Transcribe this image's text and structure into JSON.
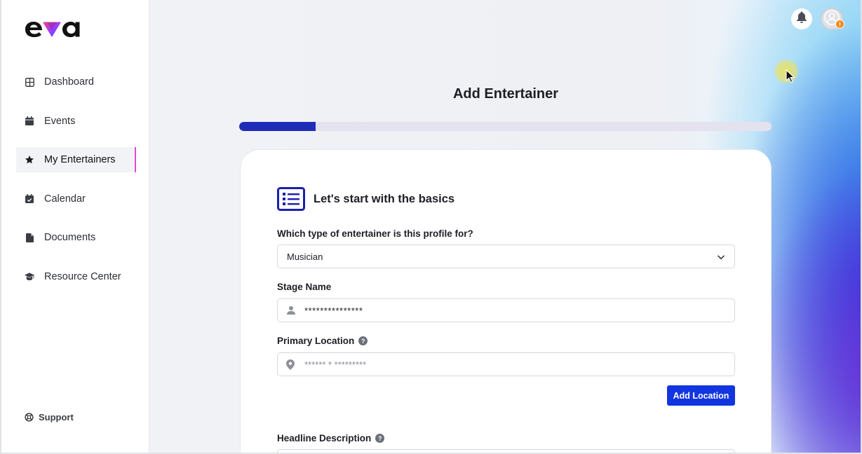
{
  "app": {
    "logo_text": "eva"
  },
  "sidebar": {
    "items": [
      {
        "label": "Dashboard",
        "icon": "grid-icon"
      },
      {
        "label": "Events",
        "icon": "calendar-icon"
      },
      {
        "label": "My Entertainers",
        "icon": "star-icon",
        "active": true
      },
      {
        "label": "Calendar",
        "icon": "calendar-check-icon"
      },
      {
        "label": "Documents",
        "icon": "document-icon"
      },
      {
        "label": "Resource Center",
        "icon": "graduation-cap-icon"
      }
    ],
    "support_label": "Support"
  },
  "header": {
    "notification_icon": "bell-icon",
    "avatar_icon": "user-avatar-icon",
    "avatar_badge": "!"
  },
  "page": {
    "title": "Add Entertainer",
    "progress_fraction": 0.143
  },
  "form": {
    "section_title": "Let's start with the basics",
    "entertainer_type": {
      "label": "Which type of entertainer is this profile for?",
      "value": "Musician"
    },
    "stage_name": {
      "label": "Stage Name",
      "value": "***************"
    },
    "primary_location": {
      "label": "Primary Location",
      "help": "?",
      "placeholder": "****** * *********"
    },
    "add_location_label": "Add Location",
    "headline_description": {
      "label": "Headline Description",
      "help": "?"
    }
  },
  "colors": {
    "primary": "#1136e0",
    "progress": "#1f2cb8",
    "active_indicator": "#e04bd6",
    "badge": "#f08a1c"
  }
}
